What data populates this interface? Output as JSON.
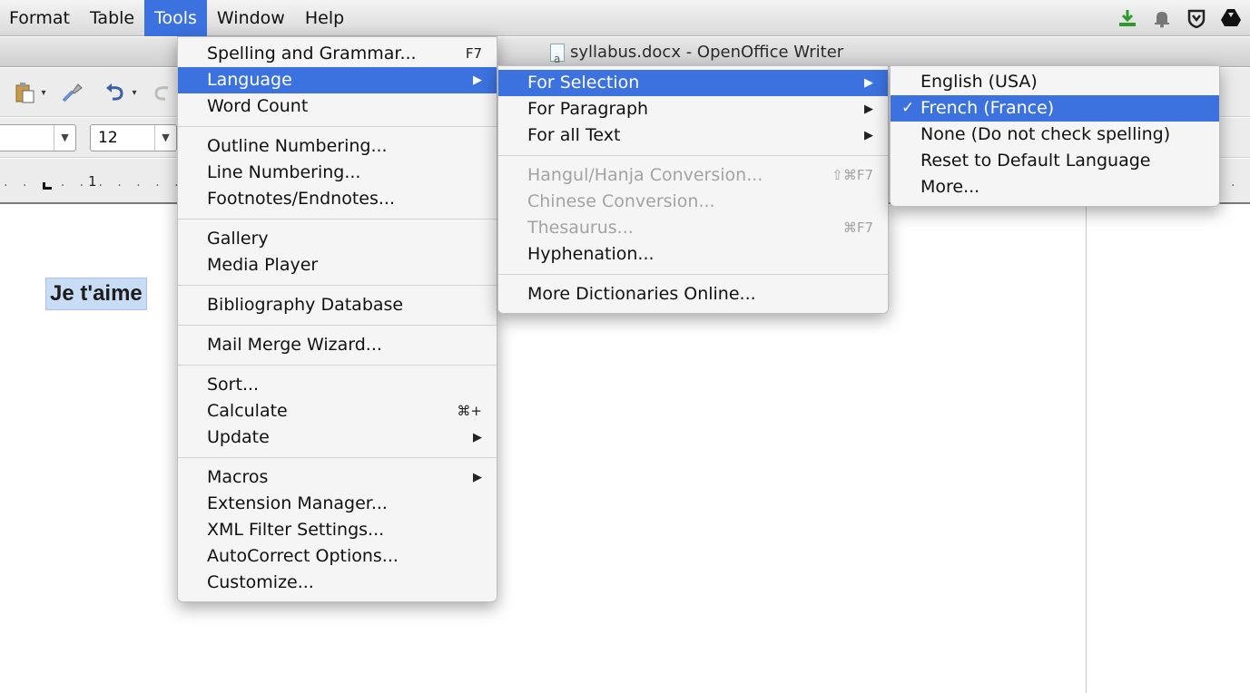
{
  "menubar": {
    "items": [
      "Format",
      "Table",
      "Tools",
      "Window",
      "Help"
    ],
    "active": "Tools",
    "status_icons": [
      "download-arrow-icon",
      "bell-icon",
      "shield-icon",
      "google-drive-icon"
    ]
  },
  "window": {
    "title": "syllabus.docx - OpenOffice Writer"
  },
  "format_bar": {
    "font_size": "12"
  },
  "ruler": {
    "mark": "1"
  },
  "document": {
    "text": "Je t'aime"
  },
  "tools_menu": {
    "spelling": "Spelling and Grammar...",
    "spelling_shortcut": "F7",
    "language": "Language",
    "word_count": "Word Count",
    "outline_numbering": "Outline Numbering...",
    "line_numbering": "Line Numbering...",
    "footnotes": "Footnotes/Endnotes...",
    "gallery": "Gallery",
    "media_player": "Media Player",
    "bibliography": "Bibliography Database",
    "mail_merge": "Mail Merge Wizard...",
    "sort": "Sort...",
    "calculate": "Calculate",
    "calculate_shortcut": "⌘+",
    "update": "Update",
    "macros": "Macros",
    "extension_manager": "Extension Manager...",
    "xml_filter": "XML Filter Settings...",
    "autocorrect": "AutoCorrect Options...",
    "customize": "Customize..."
  },
  "language_menu": {
    "for_selection": "For Selection",
    "for_paragraph": "For Paragraph",
    "for_all_text": "For all Text",
    "hangul": "Hangul/Hanja Conversion...",
    "hangul_shortcut": "⇧⌘F7",
    "chinese": "Chinese Conversion...",
    "thesaurus": "Thesaurus...",
    "thesaurus_shortcut": "⌘F7",
    "hyphenation": "Hyphenation...",
    "more_dictionaries": "More Dictionaries Online..."
  },
  "selection_menu": {
    "english": "English (USA)",
    "french": "French (France)",
    "checkmark": "✓",
    "none": "None (Do not check spelling)",
    "reset": "Reset to Default Language",
    "more": "More..."
  },
  "colors": {
    "highlight": "#3c72e0",
    "selection_bg": "#c9dcf6"
  }
}
